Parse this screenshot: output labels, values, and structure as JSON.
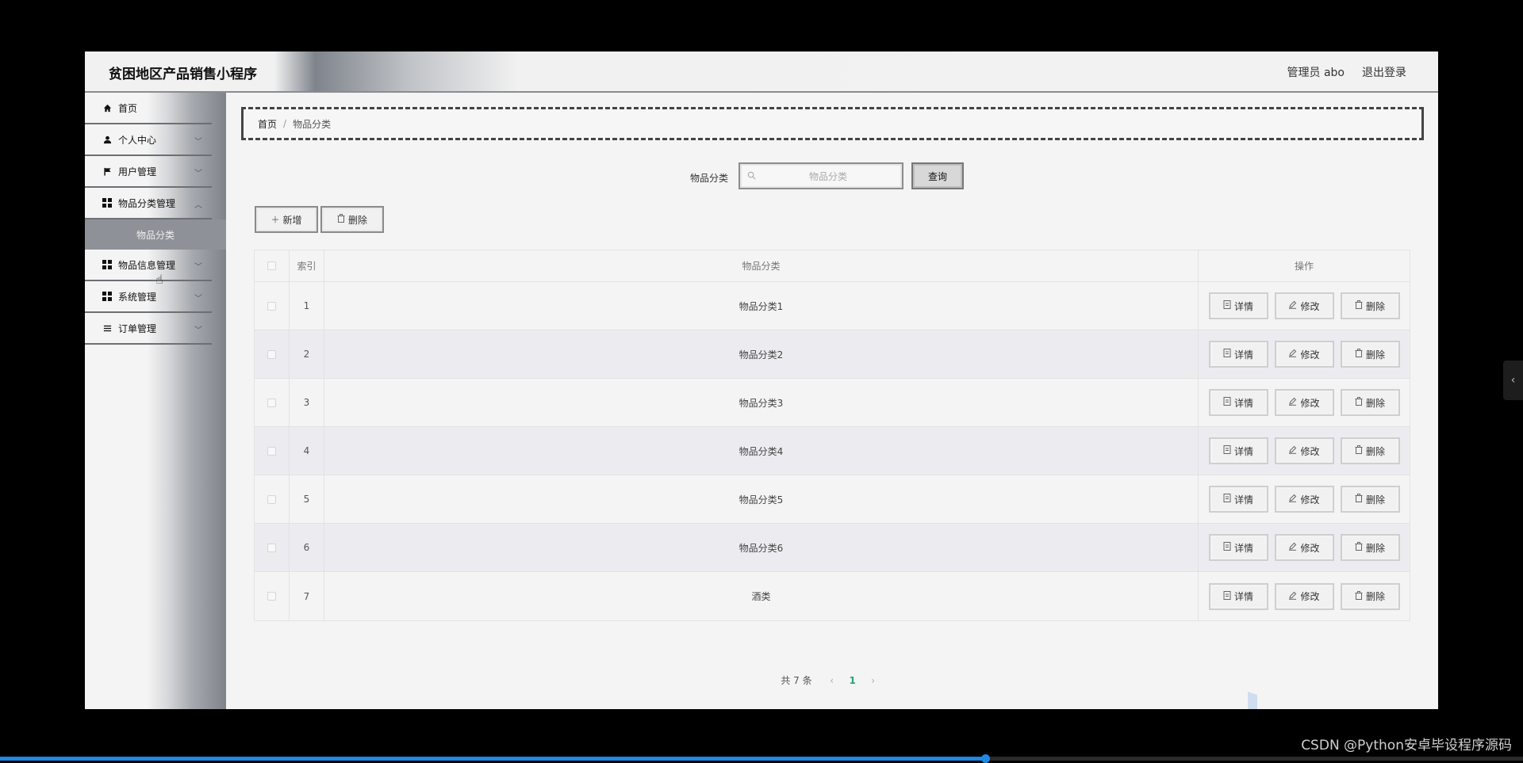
{
  "app": {
    "title": "贫困地区产品销售小程序",
    "user_label": "管理员 abo",
    "logout": "退出登录"
  },
  "sidebar": {
    "items": [
      {
        "label": "首页",
        "icon": "home-icon",
        "has_children": false
      },
      {
        "label": "个人中心",
        "icon": "user-icon",
        "has_children": true
      },
      {
        "label": "用户管理",
        "icon": "flag-icon",
        "has_children": true
      },
      {
        "label": "物品分类管理",
        "icon": "grid-icon",
        "has_children": true,
        "expanded": true,
        "children": [
          {
            "label": "物品分类",
            "active": true
          }
        ]
      },
      {
        "label": "物品信息管理",
        "icon": "grid-icon",
        "has_children": true
      },
      {
        "label": "系统管理",
        "icon": "grid-icon",
        "has_children": true
      },
      {
        "label": "订单管理",
        "icon": "list-icon",
        "has_children": true
      }
    ]
  },
  "breadcrumb": {
    "home": "首页",
    "separator": "/",
    "current": "物品分类"
  },
  "search": {
    "label": "物品分类",
    "placeholder": "物品分类",
    "value": "",
    "button": "查询"
  },
  "toolbar": {
    "add": "新增",
    "delete": "删除"
  },
  "table": {
    "columns": [
      "索引",
      "物品分类",
      "操作"
    ],
    "rows": [
      {
        "index": "1",
        "name": "物品分类1"
      },
      {
        "index": "2",
        "name": "物品分类2"
      },
      {
        "index": "3",
        "name": "物品分类3"
      },
      {
        "index": "4",
        "name": "物品分类4"
      },
      {
        "index": "5",
        "name": "物品分类5"
      },
      {
        "index": "6",
        "name": "物品分类6"
      },
      {
        "index": "7",
        "name": "酒类"
      }
    ],
    "actions": {
      "detail": "详情",
      "edit": "修改",
      "delete": "删除"
    }
  },
  "pagination": {
    "total": "共 7 条",
    "current_page": "1"
  },
  "footer": {
    "watermark_text": "CSDN @Python安卓毕设程序源码"
  },
  "video_progress": 0.647,
  "colors": {
    "accent": "#2aa37a",
    "progress": "#1e88e5"
  }
}
